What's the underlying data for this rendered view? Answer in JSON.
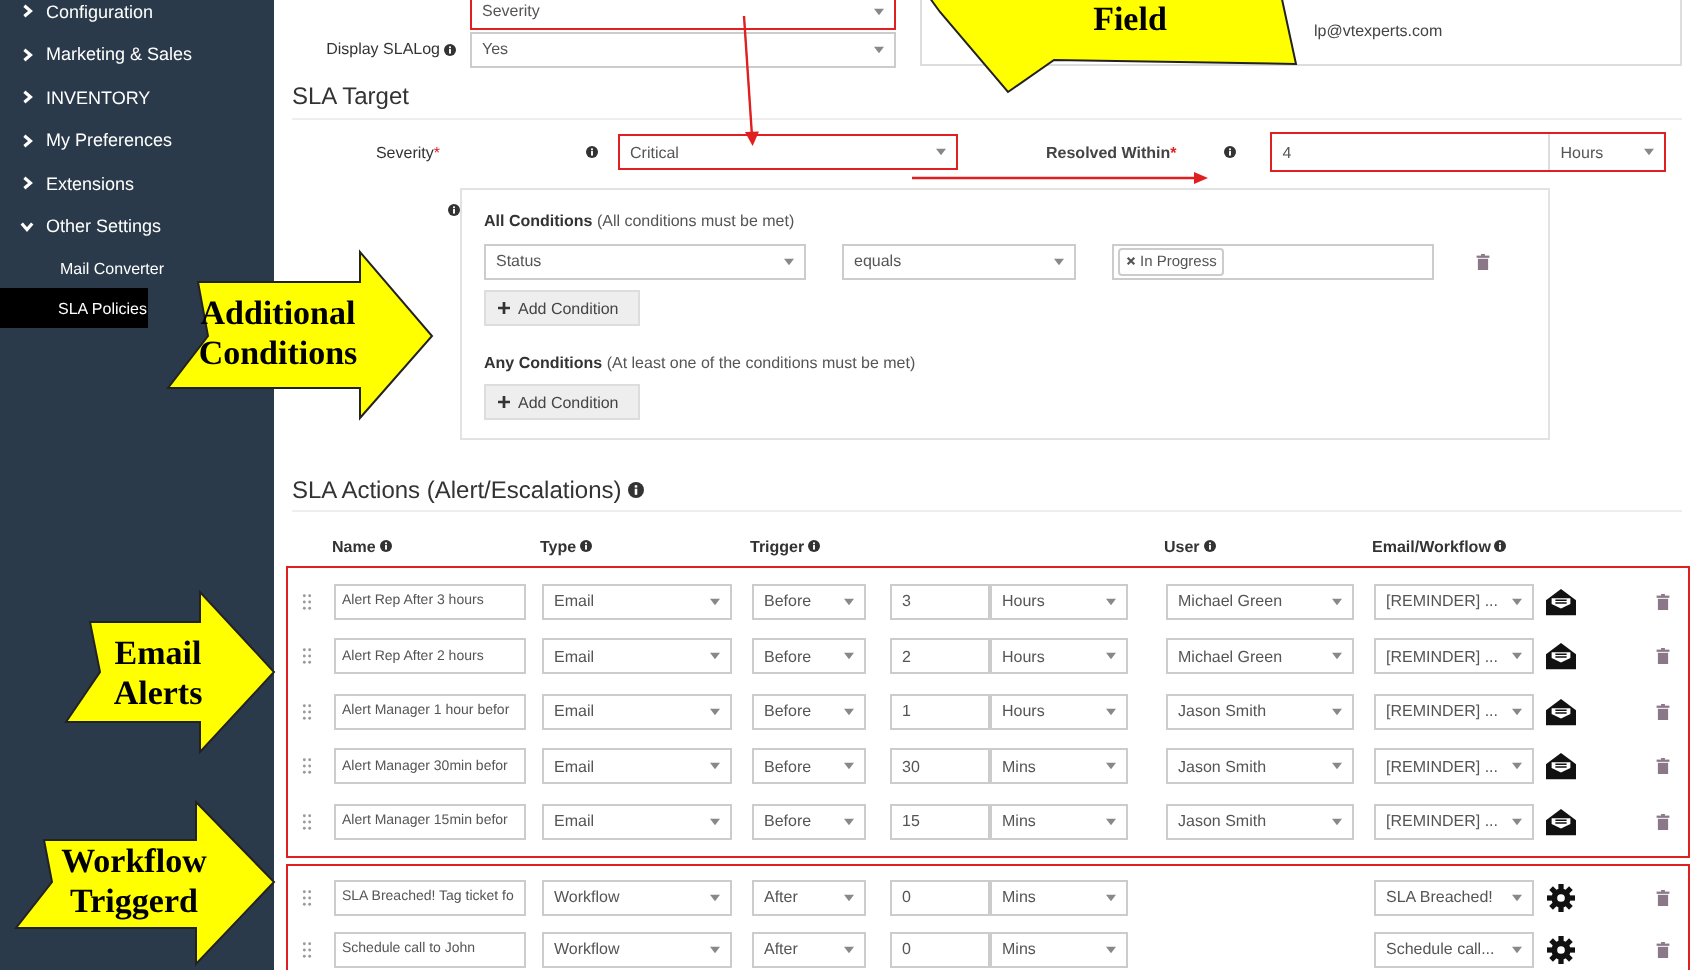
{
  "sidebar": {
    "items": [
      {
        "label": "Configuration",
        "expanded": false
      },
      {
        "label": "Marketing & Sales",
        "expanded": false
      },
      {
        "label": "INVENTORY",
        "expanded": false
      },
      {
        "label": "My Preferences",
        "expanded": false
      },
      {
        "label": "Extensions",
        "expanded": false
      },
      {
        "label": "Other Settings",
        "expanded": true,
        "children": [
          {
            "label": "Mail Converter",
            "selected": false
          },
          {
            "label": "SLA Policies",
            "selected": true
          }
        ]
      }
    ]
  },
  "top_fields": [
    {
      "value": "Severity",
      "highlighted": true
    },
    {
      "label": "Display SLALog",
      "value": "Yes",
      "highlighted": false
    }
  ],
  "info_panel": {
    "text": "lp@vtexperts.com"
  },
  "sla_target": {
    "heading": "SLA Target",
    "severity": {
      "label": "Severity",
      "required_mark": "*",
      "value": "Critical",
      "highlighted": true
    },
    "resolved_within": {
      "label": "Resolved Within",
      "required_mark": "*",
      "value": "4",
      "unit": "Hours",
      "highlighted": true
    },
    "conditions": [
      {
        "text": "**All Conditions** (All conditions must be met)",
        "rows": [
          {
            "field": "Status",
            "operator": "equals",
            "values": [
              "In Progress"
            ]
          }
        ],
        "button": "Add Condition"
      },
      {
        "text": "**Any Conditions** (At least one of the conditions must be met)",
        "button": "Add Condition"
      }
    ]
  },
  "sla_actions": {
    "heading": "SLA Actions (Alert/Escalations)",
    "columns": [
      "Name",
      "Type",
      "Trigger",
      "User",
      "Email/Workflow"
    ],
    "groups": [
      {
        "highlighted": true,
        "rows": [
          {
            "kind": "email",
            "name": "Alert Rep After 3 hours",
            "type": "Email",
            "trigger": "Before",
            "amount": "3",
            "unit": "Hours",
            "user": "Michael Green",
            "template": "[REMINDER] ..."
          },
          {
            "kind": "email",
            "name": "Alert Rep After 2 hours",
            "type": "Email",
            "trigger": "Before",
            "amount": "2",
            "unit": "Hours",
            "user": "Michael Green",
            "template": "[REMINDER] ..."
          },
          {
            "kind": "email",
            "name": "Alert Manager 1 hour befor",
            "type": "Email",
            "trigger": "Before",
            "amount": "1",
            "unit": "Hours",
            "user": "Jason Smith",
            "template": "[REMINDER] ..."
          },
          {
            "kind": "email",
            "name": "Alert Manager 30min befor",
            "type": "Email",
            "trigger": "Before",
            "amount": "30",
            "unit": "Mins",
            "user": "Jason Smith",
            "template": "[REMINDER] ..."
          },
          {
            "kind": "email",
            "name": "Alert Manager 15min befor",
            "type": "Email",
            "trigger": "Before",
            "amount": "15",
            "unit": "Mins",
            "user": "Jason Smith",
            "template": "[REMINDER] ..."
          }
        ]
      },
      {
        "highlighted": true,
        "rows": [
          {
            "kind": "workflow",
            "name": "SLA Breached! Tag ticket fo",
            "type": "Workflow",
            "trigger": "After",
            "amount": "0",
            "unit": "Mins",
            "template": "SLA Breached!"
          },
          {
            "kind": "workflow",
            "name": "Schedule call to John",
            "type": "Workflow",
            "trigger": "After",
            "amount": "0",
            "unit": "Mins",
            "template": "Schedule call..."
          }
        ]
      }
    ]
  },
  "callouts": [
    {
      "text": "Field"
    },
    {
      "text": "Additional Conditions"
    },
    {
      "text": "Email Alerts"
    },
    {
      "text": "Workflow Triggerd"
    }
  ]
}
